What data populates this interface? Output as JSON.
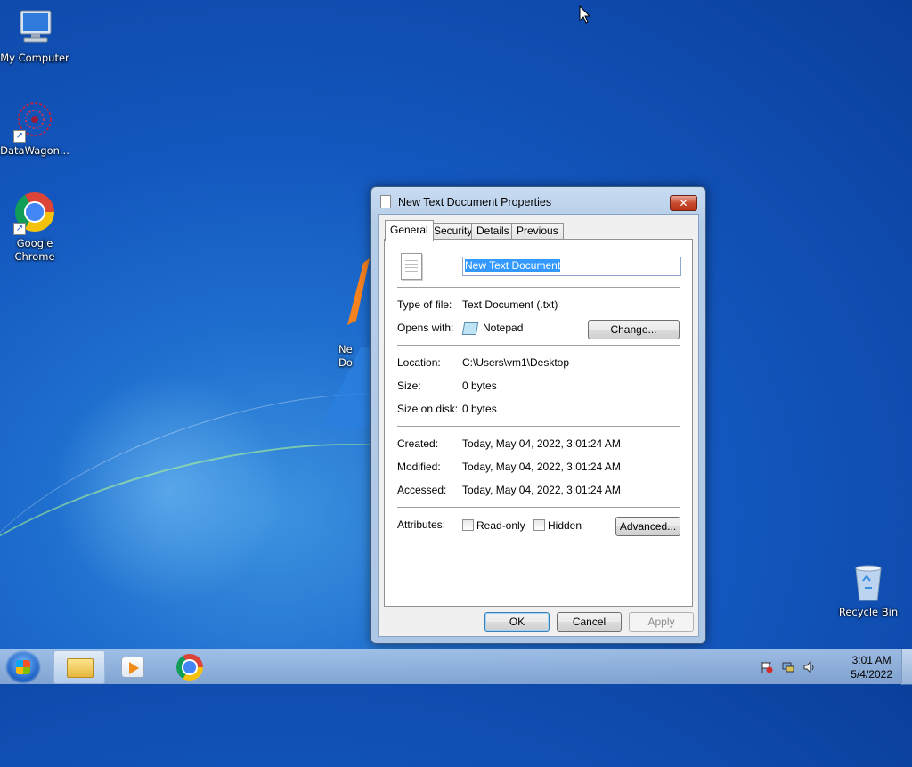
{
  "desktop": {
    "icons": [
      {
        "label": "My Computer",
        "icon": "computer-icon"
      },
      {
        "label": "DataWagon...",
        "icon": "datawagon-icon"
      },
      {
        "label": "Google\nChrome",
        "icon": "chrome-icon"
      },
      {
        "label": "Recycle Bin",
        "icon": "recycle-bin-icon"
      }
    ],
    "partial_icon_label": "Ne\nDo"
  },
  "dialog": {
    "title": "New Text Document Properties",
    "close_label": "✕",
    "tabs": [
      "General",
      "Security",
      "Details",
      "Previous Versions"
    ],
    "active_tab": "General",
    "file_name": "New Text Document",
    "type_of_file_label": "Type of file:",
    "type_of_file": "Text Document (.txt)",
    "opens_with_label": "Opens with:",
    "opens_with": "Notepad",
    "change_button": "Change...",
    "location_label": "Location:",
    "location": "C:\\Users\\vm1\\Desktop",
    "size_label": "Size:",
    "size": "0 bytes",
    "size_on_disk_label": "Size on disk:",
    "size_on_disk": "0 bytes",
    "created_label": "Created:",
    "created": "Today, May 04, 2022, 3:01:24 AM",
    "modified_label": "Modified:",
    "modified": "Today, May 04, 2022, 3:01:24 AM",
    "accessed_label": "Accessed:",
    "accessed": "Today, May 04, 2022, 3:01:24 AM",
    "attributes_label": "Attributes:",
    "readonly_label": "Read-only",
    "readonly_checked": false,
    "hidden_label": "Hidden",
    "hidden_checked": false,
    "advanced_button": "Advanced...",
    "ok_button": "OK",
    "cancel_button": "Cancel",
    "apply_button": "Apply"
  },
  "taskbar": {
    "pinned": [
      "windows-explorer-icon",
      "media-player-icon",
      "chrome-icon"
    ],
    "time": "3:01 AM",
    "date": "5/4/2022",
    "tray_icons": [
      "action-center-flag-icon",
      "network-icon",
      "volume-icon"
    ]
  },
  "colors": {
    "desktop_blue": "#1357be",
    "selection": "#3399ff",
    "close_red": "#c74b30"
  }
}
